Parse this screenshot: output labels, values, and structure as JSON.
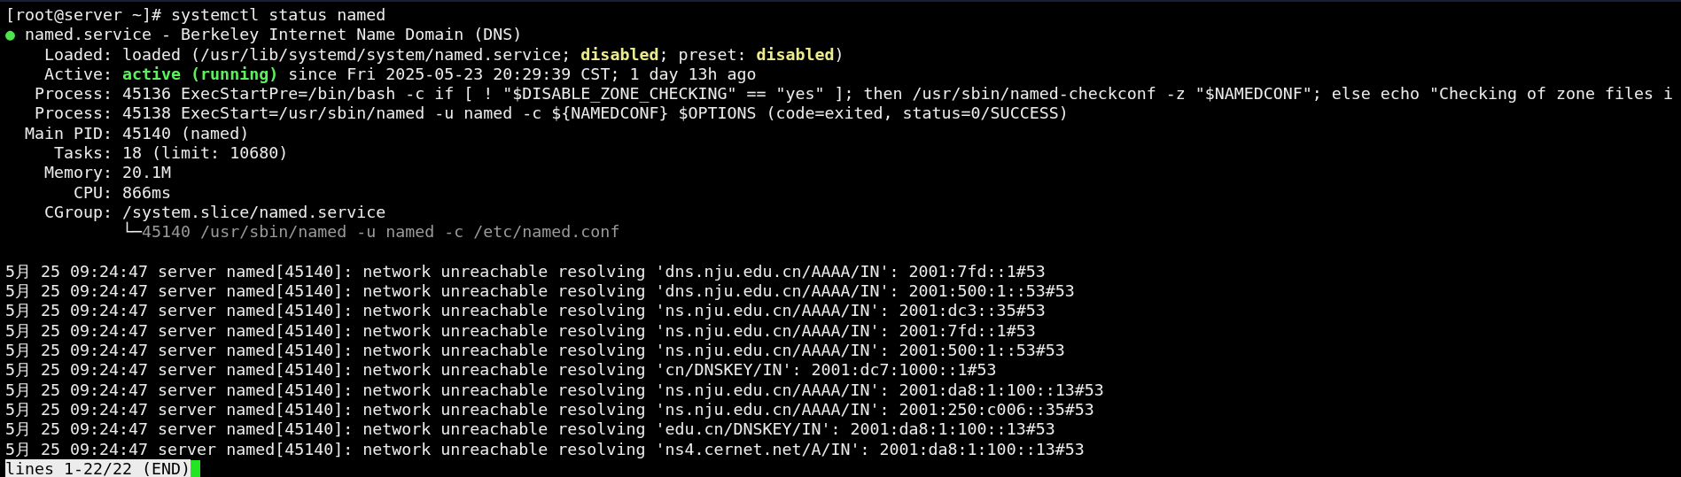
{
  "prompt": "[root@server ~]# systemctl status named",
  "unit": {
    "dot": "●",
    "color": "#4ee44e",
    "title": "named.service - Berkeley Internet Name Domain (DNS)"
  },
  "fields": [
    {
      "label": "Loaded:",
      "segments": [
        {
          "kind": "plain",
          "text": "loaded (/usr/lib/systemd/system/named.service; "
        },
        {
          "kind": "warn",
          "text": "disabled"
        },
        {
          "kind": "plain",
          "text": "; preset: "
        },
        {
          "kind": "warn",
          "text": "disabled"
        },
        {
          "kind": "plain",
          "text": ")"
        }
      ]
    },
    {
      "label": "Active:",
      "segments": [
        {
          "kind": "ok",
          "text": "active (running)"
        },
        {
          "kind": "plain",
          "text": " since Fri 2025-05-23 20:29:39 CST; 1 day 13h ago"
        }
      ]
    },
    {
      "label": "Process:",
      "segments": [
        {
          "kind": "plain",
          "text": "45136 ExecStartPre=/bin/bash -c if [ ! \"$DISABLE_ZONE_CHECKING\" == \"yes\" ]; then /usr/sbin/named-checkconf -z \"$NAMEDCONF\"; else echo \"Checking of zone files i"
        }
      ]
    },
    {
      "label": "Process:",
      "segments": [
        {
          "kind": "plain",
          "text": "45138 ExecStart=/usr/sbin/named -u named -c ${NAMEDCONF} $OPTIONS (code=exited, status=0/SUCCESS)"
        }
      ]
    },
    {
      "label": "Main PID:",
      "segments": [
        {
          "kind": "plain",
          "text": "45140 (named)"
        }
      ]
    },
    {
      "label": "Tasks:",
      "segments": [
        {
          "kind": "plain",
          "text": "18 (limit: 10680)"
        }
      ]
    },
    {
      "label": "Memory:",
      "segments": [
        {
          "kind": "plain",
          "text": "20.1M"
        }
      ]
    },
    {
      "label": "CPU:",
      "segments": [
        {
          "kind": "plain",
          "text": "866ms"
        }
      ]
    },
    {
      "label": "CGroup:",
      "segments": [
        {
          "kind": "plain",
          "text": "/system.slice/named.service"
        }
      ],
      "children": [
        {
          "branch": "└─",
          "text": "45140 /usr/sbin/named -u named -c /etc/named.conf"
        }
      ]
    }
  ],
  "log_lines": [
    "5月 25 09:24:47 server named[45140]: network unreachable resolving 'dns.nju.edu.cn/AAAA/IN': 2001:7fd::1#53",
    "5月 25 09:24:47 server named[45140]: network unreachable resolving 'dns.nju.edu.cn/AAAA/IN': 2001:500:1::53#53",
    "5月 25 09:24:47 server named[45140]: network unreachable resolving 'ns.nju.edu.cn/AAAA/IN': 2001:dc3::35#53",
    "5月 25 09:24:47 server named[45140]: network unreachable resolving 'ns.nju.edu.cn/AAAA/IN': 2001:7fd::1#53",
    "5月 25 09:24:47 server named[45140]: network unreachable resolving 'ns.nju.edu.cn/AAAA/IN': 2001:500:1::53#53",
    "5月 25 09:24:47 server named[45140]: network unreachable resolving 'cn/DNSKEY/IN': 2001:dc7:1000::1#53",
    "5月 25 09:24:47 server named[45140]: network unreachable resolving 'ns.nju.edu.cn/AAAA/IN': 2001:da8:1:100::13#53",
    "5月 25 09:24:47 server named[45140]: network unreachable resolving 'ns.nju.edu.cn/AAAA/IN': 2001:250:c006::35#53",
    "5月 25 09:24:47 server named[45140]: network unreachable resolving 'edu.cn/DNSKEY/IN': 2001:da8:1:100::13#53",
    "5月 25 09:24:47 server named[45140]: network unreachable resolving 'ns4.cernet.net/A/IN': 2001:da8:1:100::13#53"
  ],
  "pager": {
    "text": "lines 1-22/22 (END)"
  }
}
